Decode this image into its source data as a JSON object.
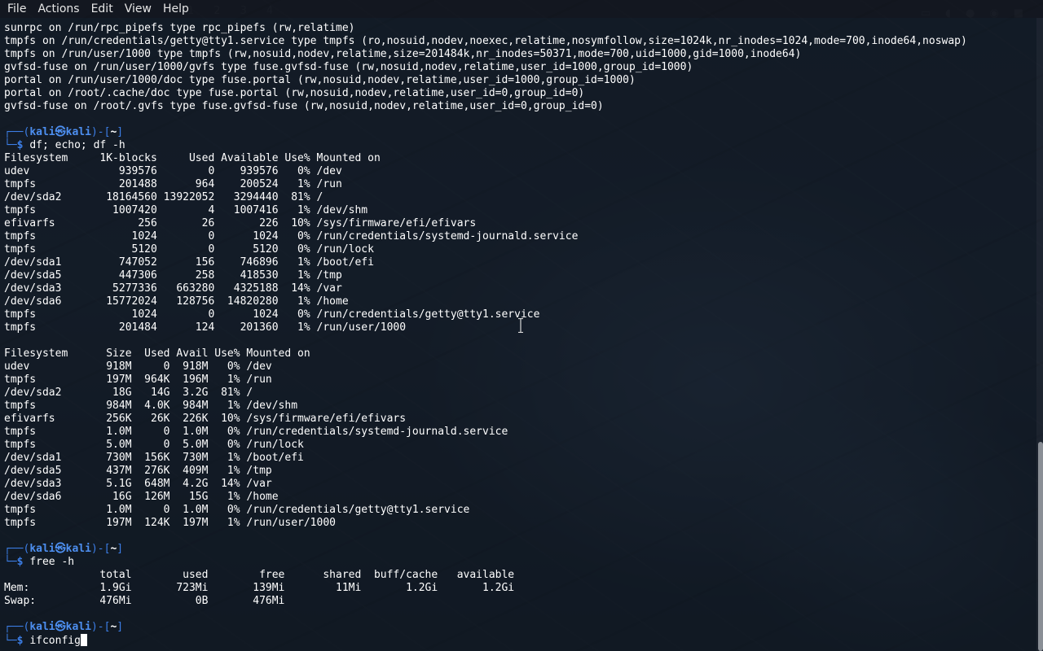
{
  "window": {
    "menu": [
      "File",
      "Actions",
      "Edit",
      "View",
      "Help"
    ]
  },
  "background_workspaces": [
    "1",
    "2",
    "3",
    "4"
  ],
  "terminal": {
    "mount_lines": [
      "sunrpc on /run/rpc_pipefs type rpc_pipefs (rw,relatime)",
      "tmpfs on /run/credentials/getty@tty1.service type tmpfs (ro,nosuid,nodev,noexec,relatime,nosymfollow,size=1024k,nr_inodes=1024,mode=700,inode64,noswap)",
      "tmpfs on /run/user/1000 type tmpfs (rw,nosuid,nodev,relatime,size=201484k,nr_inodes=50371,mode=700,uid=1000,gid=1000,inode64)",
      "gvfsd-fuse on /run/user/1000/gvfs type fuse.gvfsd-fuse (rw,nosuid,nodev,relatime,user_id=1000,group_id=1000)",
      "portal on /run/user/1000/doc type fuse.portal (rw,nosuid,nodev,relatime,user_id=1000,group_id=1000)",
      "portal on /root/.cache/doc type fuse.portal (rw,nosuid,nodev,relatime,user_id=0,group_id=0)",
      "gvfsd-fuse on /root/.gvfs type fuse.gvfsd-fuse (rw,nosuid,nodev,relatime,user_id=0,group_id=0)"
    ],
    "prompt": {
      "top_left": "┌──(",
      "user": "kali",
      "at": "㉿",
      "host": "kali",
      "mid": ")-[",
      "dir": "~",
      "end": "]",
      "bottom_left": "└─",
      "dollar": "$ "
    },
    "commands": [
      "df; echo; df -h",
      "free -h",
      "ifconfig"
    ],
    "df_lines": [
      "Filesystem     1K-blocks     Used Available Use% Mounted on",
      "udev              939576        0    939576   0% /dev",
      "tmpfs             201488      964    200524   1% /run",
      "/dev/sda2       18164560 13922052   3294440  81% /",
      "tmpfs            1007420        4   1007416   1% /dev/shm",
      "efivarfs             256       26       226  10% /sys/firmware/efi/efivars",
      "tmpfs               1024        0      1024   0% /run/credentials/systemd-journald.service",
      "tmpfs               5120        0      5120   0% /run/lock",
      "/dev/sda1         747052      156    746896   1% /boot/efi",
      "/dev/sda5         447306      258    418530   1% /tmp",
      "/dev/sda3        5277336   663280   4325188  14% /var",
      "/dev/sda6       15772024   128756  14820280   1% /home",
      "tmpfs               1024        0      1024   0% /run/credentials/getty@tty1.service",
      "tmpfs             201484      124    201360   1% /run/user/1000"
    ],
    "dfh_lines": [
      "Filesystem      Size  Used Avail Use% Mounted on",
      "udev            918M     0  918M   0% /dev",
      "tmpfs           197M  964K  196M   1% /run",
      "/dev/sda2        18G   14G  3.2G  81% /",
      "tmpfs           984M  4.0K  984M   1% /dev/shm",
      "efivarfs        256K   26K  226K  10% /sys/firmware/efi/efivars",
      "tmpfs           1.0M     0  1.0M   0% /run/credentials/systemd-journald.service",
      "tmpfs           5.0M     0  5.0M   0% /run/lock",
      "/dev/sda1       730M  156K  730M   1% /boot/efi",
      "/dev/sda5       437M  276K  409M   1% /tmp",
      "/dev/sda3       5.1G  648M  4.2G  14% /var",
      "/dev/sda6        16G  126M   15G   1% /home",
      "tmpfs           1.0M     0  1.0M   0% /run/credentials/getty@tty1.service",
      "tmpfs           197M  124K  197M   1% /run/user/1000"
    ],
    "free_lines": [
      "               total        used        free      shared  buff/cache   available",
      "Mem:           1.9Gi       723Mi       139Mi        11Mi       1.2Gi       1.2Gi",
      "Swap:          476Mi          0B       476Mi"
    ]
  },
  "colors": {
    "prompt_blue": "#3c7ee6",
    "terminal_text": "#ffffff",
    "menubar_text": "#e6e6e6"
  }
}
